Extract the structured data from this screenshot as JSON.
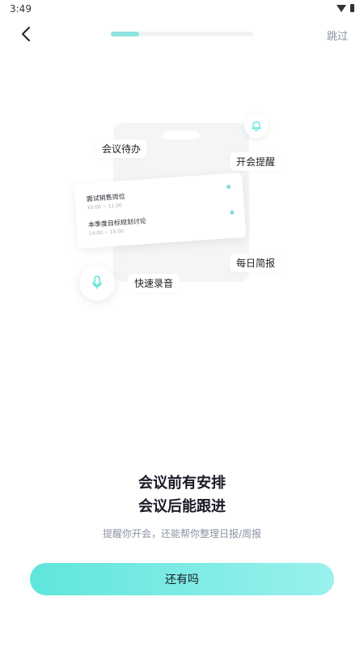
{
  "status_bar": {
    "time": "3:49",
    "icons": [
      "wifi-icon",
      "battery-icon"
    ]
  },
  "nav": {
    "back_icon": "chevron-left-icon",
    "skip_label": "跳过",
    "progress_fraction": 0.2
  },
  "illustration": {
    "tags": {
      "todo": "会议待办",
      "reminder": "开会提醒",
      "daily_report": "每日简报",
      "quick_record": "快速录音"
    },
    "schedule": [
      {
        "title": "面试销售岗位",
        "time": "10:00 ~ 11:00"
      },
      {
        "title": "本季度目标规划讨论",
        "time": "14:00 ~ 15:00"
      }
    ],
    "icons": [
      "bell-icon",
      "microphone-icon"
    ]
  },
  "content": {
    "headline_line1": "会议前有安排",
    "headline_line2": "会议后能跟进",
    "subtitle": "提醒你开会，还能帮你整理日报/周报"
  },
  "cta": {
    "label": "还有吗"
  },
  "colors": {
    "accent": "#5fe6dc",
    "accent_light": "#9af0ec",
    "muted_text": "#8c93a4",
    "progress_track": "#f1f3f4"
  }
}
